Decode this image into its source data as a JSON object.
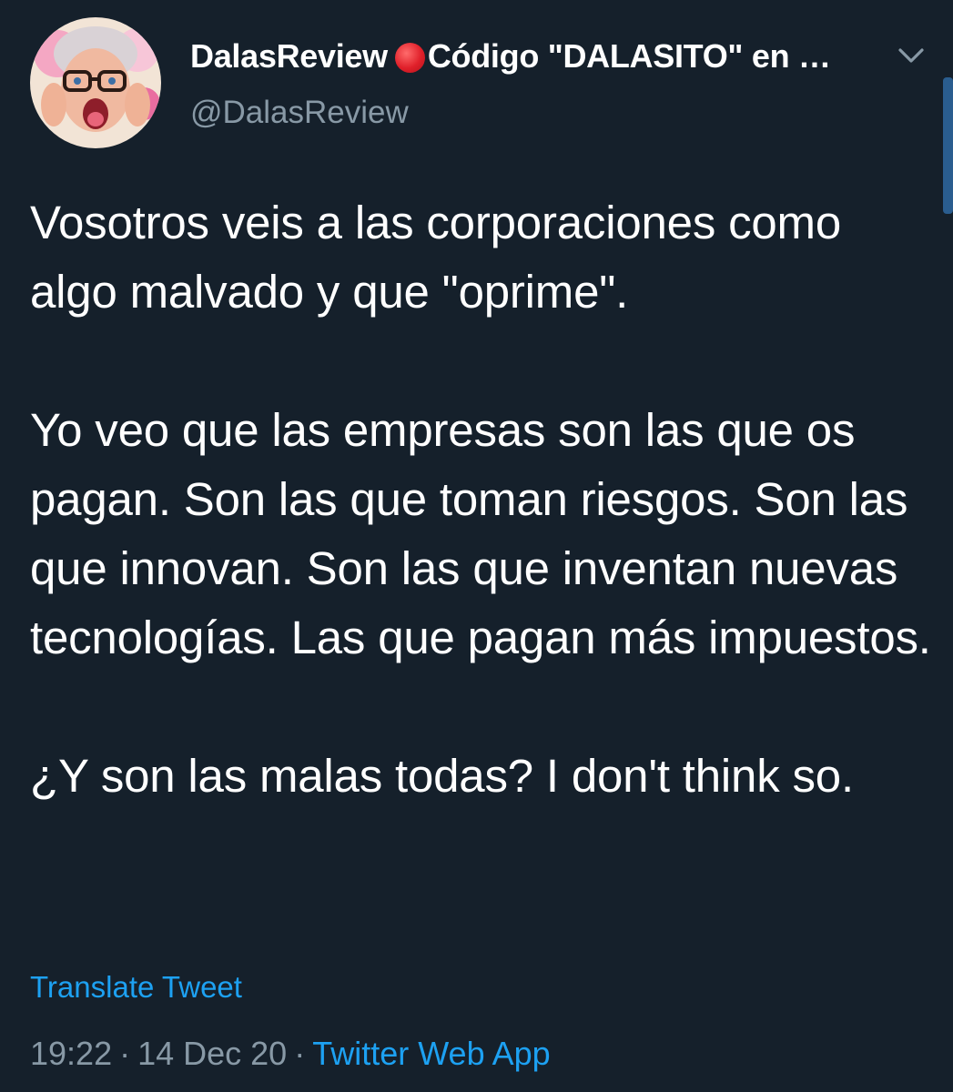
{
  "tweet": {
    "display_name": "DalasReview",
    "name_suffix": "Código \"DALASITO\" en …",
    "handle": "@DalasReview",
    "paragraphs": [
      "Vosotros veis a las corporaciones como algo malvado y que \"oprime\".",
      "Yo veo que las empresas son las que os pagan. Son las que toman riesgos. Son las que innovan. Son las que inventan nuevas tecnologías. Las que pagan más impuestos.",
      "¿Y son las malas todas? I don't think so."
    ],
    "translate_label": "Translate Tweet",
    "time": "19:22",
    "separator": "·",
    "date": "14 Dec 20",
    "source": "Twitter Web App"
  },
  "colors": {
    "background": "#15202b",
    "text": "#ffffff",
    "secondary": "#8899a6",
    "accent": "#1da1f2",
    "live_dot": "#e0202a"
  },
  "icons": {
    "caret": "chevron-down-icon",
    "status": "red-circle-icon"
  }
}
